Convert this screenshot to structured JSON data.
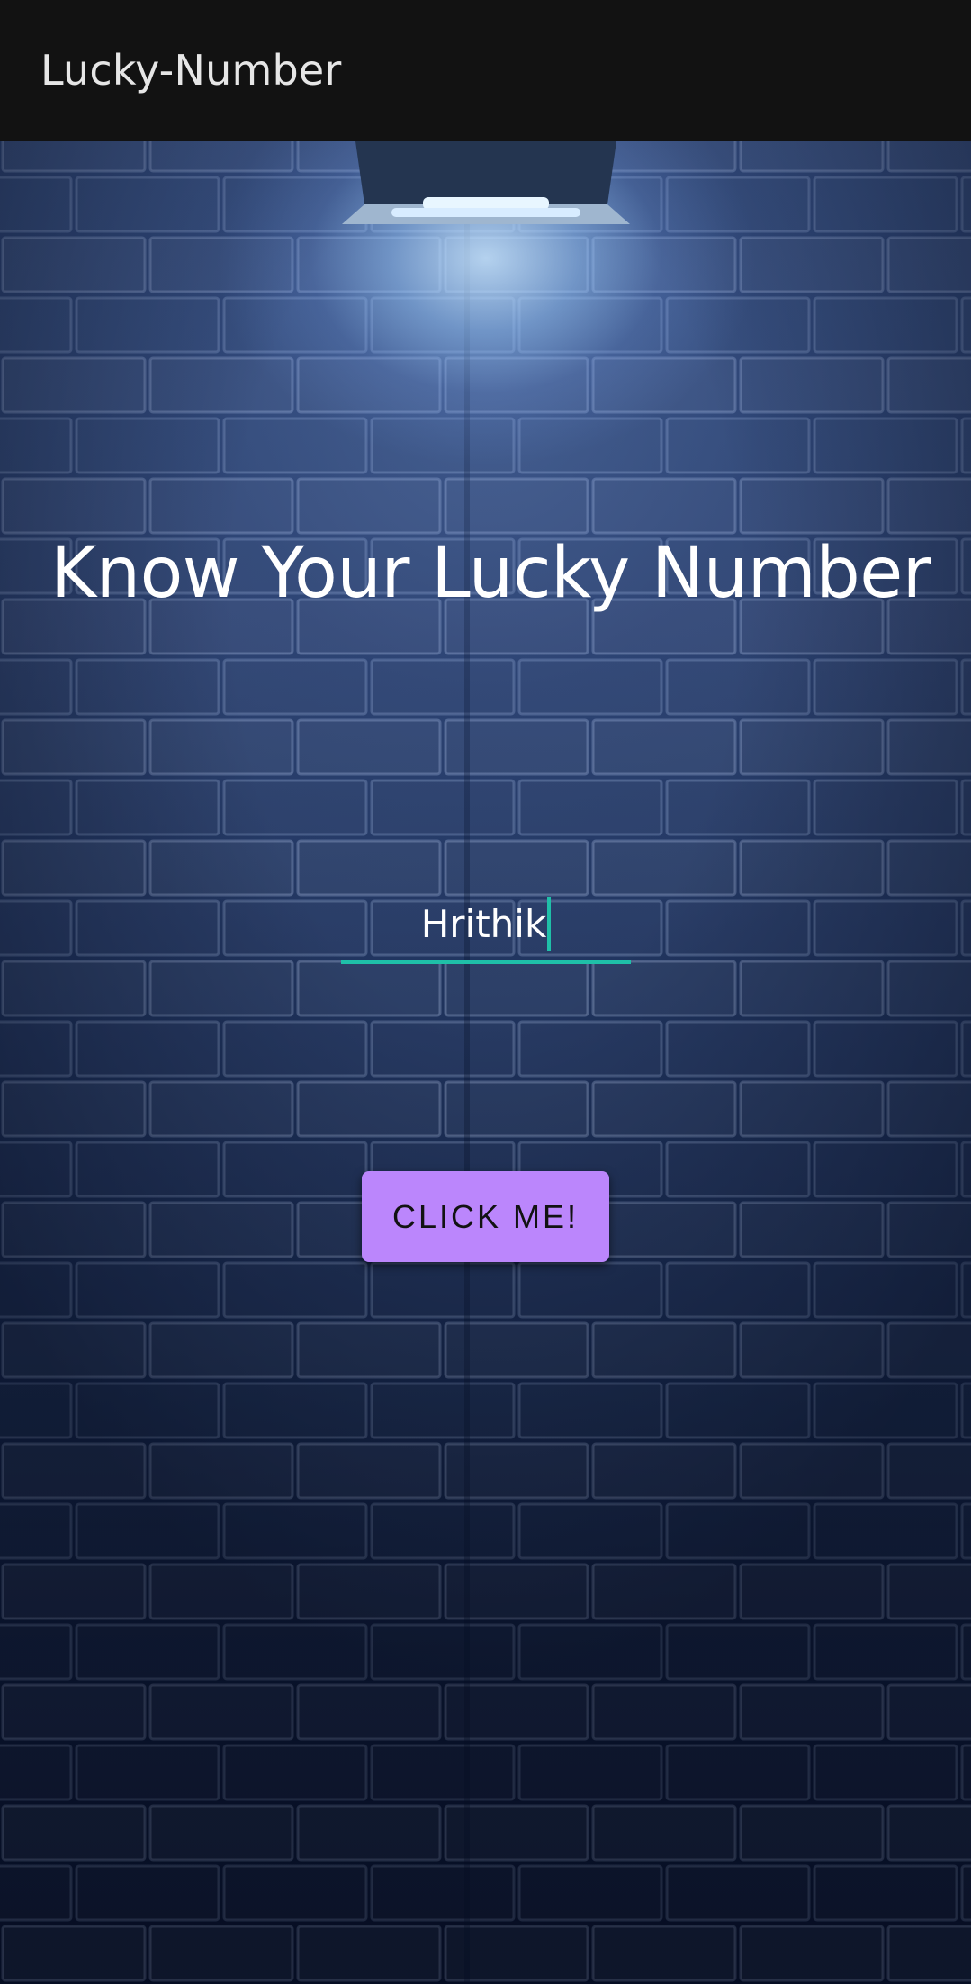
{
  "app_bar": {
    "title": "Lucky-Number"
  },
  "main": {
    "headline": "Know Your Lucky Number",
    "name_input": {
      "value": "Hrithik"
    },
    "button": {
      "label": "CLICK ME!"
    }
  },
  "colors": {
    "app_bar_background": "#121212",
    "accent": "#1fbfa8",
    "button_background": "#bb86fc",
    "wall": "#20345e"
  },
  "background": {
    "icon": "spotlight-brick-wall"
  }
}
